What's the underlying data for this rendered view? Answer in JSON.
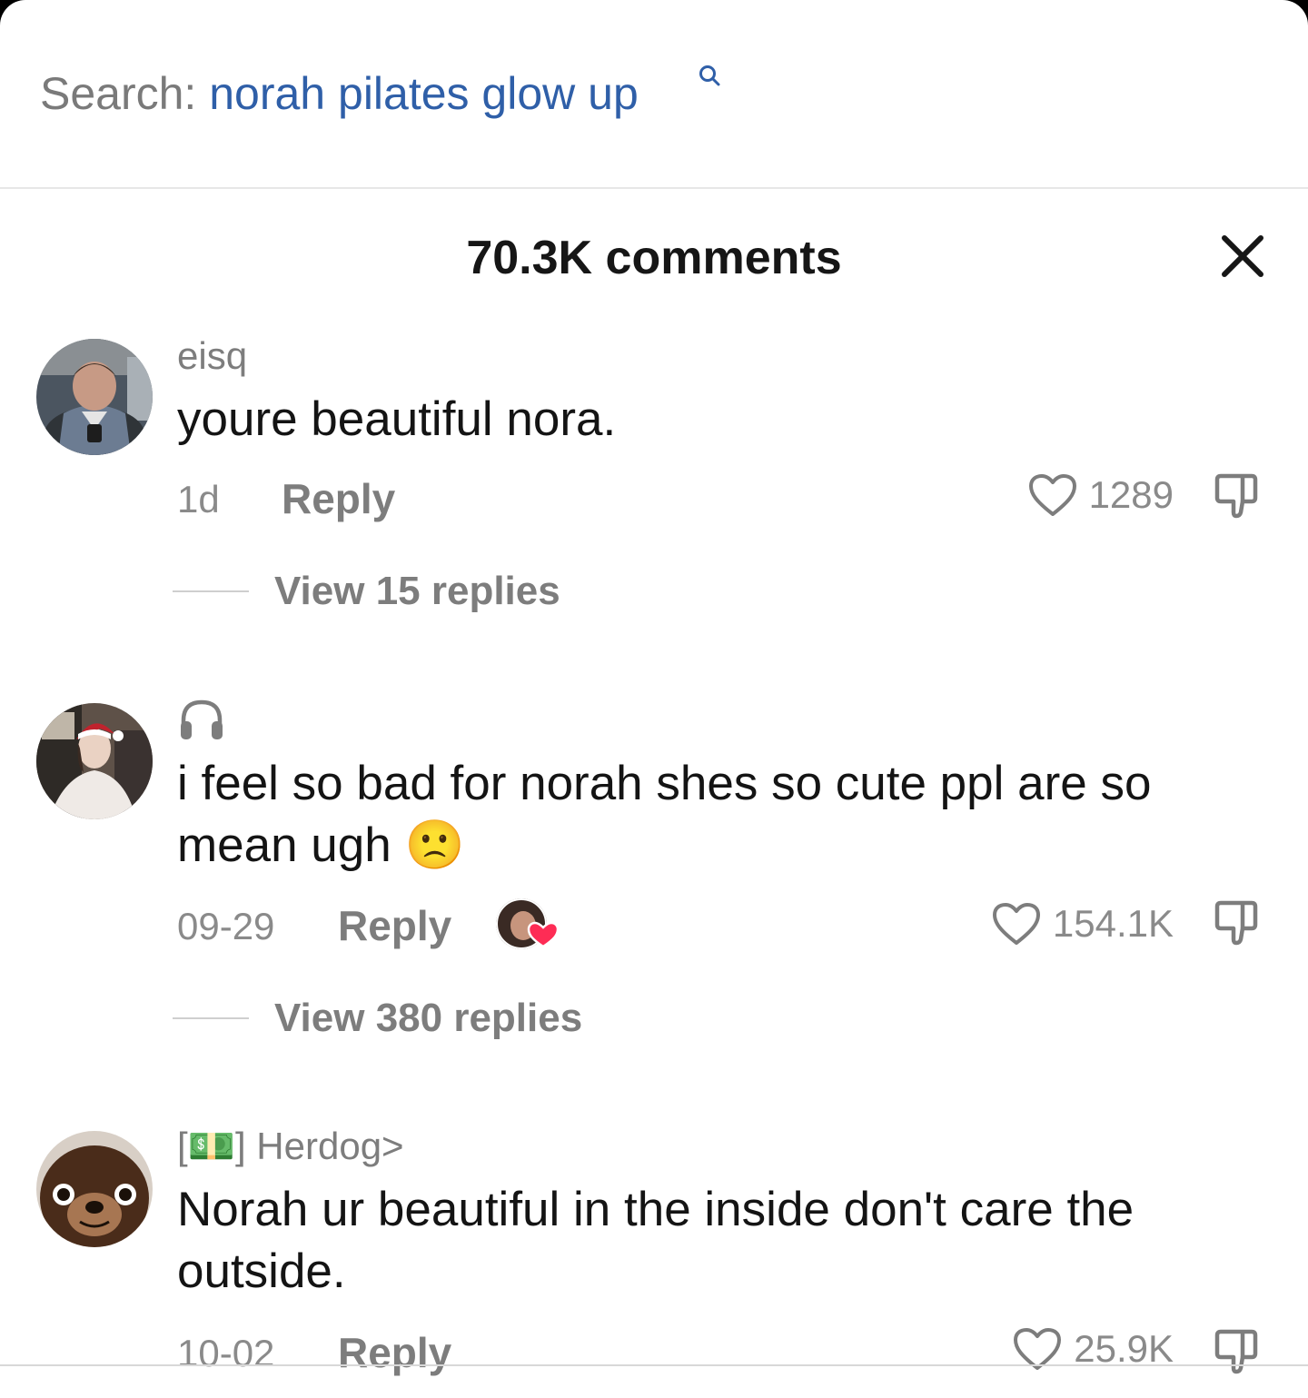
{
  "search": {
    "label": "Search:",
    "query": "norah pilates glow up",
    "icon": "search-icon"
  },
  "header": {
    "title": "70.3K comments",
    "close_icon": "close-icon"
  },
  "comments": [
    {
      "username": "eisq",
      "text": "youre beautiful nora.",
      "time": "1d",
      "reply_label": "Reply",
      "likes": "1289",
      "view_replies": "View 15 replies"
    },
    {
      "username": "",
      "username_icon": "headphones-icon",
      "text": "i feel so bad for norah shes so cute ppl are so mean ugh 🙁",
      "time": "09-29",
      "reply_label": "Reply",
      "creator_liked": true,
      "likes": "154.1K",
      "view_replies": "View 380 replies"
    },
    {
      "username": "[💵] Herdog>",
      "text": "Norah ur beautiful in the inside don't care the outside.",
      "time": "10-02",
      "reply_label": "Reply",
      "likes": "25.9K"
    }
  ],
  "colors": {
    "query_blue": "#2f5fa8",
    "heart_red": "#fe2c55",
    "text_gray": "#7d7d7d"
  }
}
